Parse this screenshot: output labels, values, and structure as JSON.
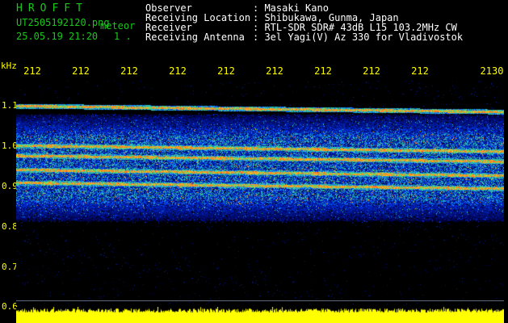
{
  "header": {
    "brand": "HROFFT",
    "filename": "UT2505192120.png",
    "mode": "meteor",
    "datetime": "25.05.19 21:20",
    "counter": "1 .",
    "fields": [
      {
        "label": "Observer",
        "value": ": Masaki Kano"
      },
      {
        "label": "Receiving Location",
        "value": ": Shibukawa, Gunma, Japan"
      },
      {
        "label": "Receiver",
        "value": ": RTL-SDR SDR# 43dB L15 103.2MHz CW"
      },
      {
        "label": "Receiving Antenna",
        "value": ": 3el Yagi(V) Az 330 for Vladivostok"
      }
    ]
  },
  "axes": {
    "y_unit": "kHz",
    "y_ticks": [
      "1.1",
      "1.0",
      "0.9",
      "0.8",
      "0.7",
      "0.6"
    ],
    "x_ticks": [
      "212",
      "212",
      "212",
      "212",
      "212",
      "212",
      "212",
      "212",
      "212",
      "2130"
    ]
  },
  "colors": {
    "header_green": "#19c819",
    "axis_yellow": "#ffff00",
    "text_white": "#ffffff",
    "background": "#000000"
  },
  "spectrogram": {
    "freq_range_khz": [
      0.6,
      1.12
    ],
    "traces_khz": [
      1.058,
      0.96,
      0.935,
      0.9,
      0.868
    ],
    "noise_band_khz": [
      0.79,
      1.02
    ]
  }
}
